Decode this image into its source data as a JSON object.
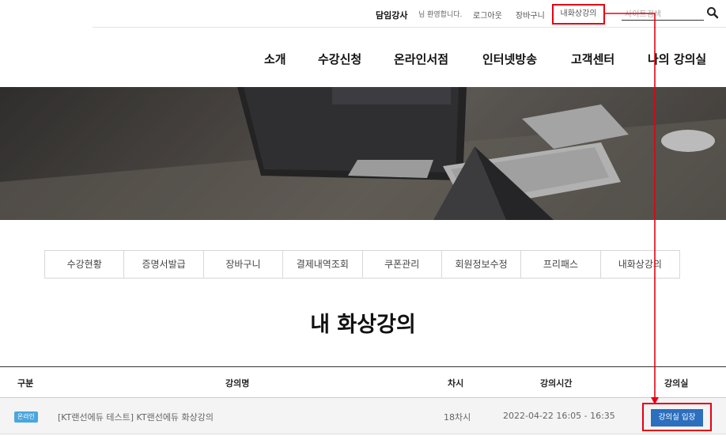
{
  "topbar": {
    "user_name": "담임강사",
    "welcome": "님 환영합니다.",
    "logout": "로그아웃",
    "cart": "장바구니",
    "my_video_class": "내화상강의",
    "search_placeholder": "사이트검색",
    "search_icon": "search-icon"
  },
  "nav": {
    "items": [
      "소개",
      "수강신청",
      "온라인서점",
      "인터넷방송",
      "고객센터",
      "나의 강의실"
    ]
  },
  "subtabs": [
    "수강현황",
    "증명서발급",
    "장바구니",
    "결제내역조회",
    "쿠폰관리",
    "회원정보수정",
    "프리패스",
    "내화상강의"
  ],
  "page_title": "내 화상강의",
  "table": {
    "headers": {
      "type": "구분",
      "name": "강의명",
      "session": "차시",
      "time": "강의시간",
      "room": "강의실"
    },
    "rows": [
      {
        "badge": "온라인",
        "name": "[KT랜선에듀 테스트] KT랜선에듀 화상강의",
        "session": "18차시",
        "time": "2022-04-22 16:05 - 16:35",
        "button": "강의실 입장"
      }
    ]
  },
  "colors": {
    "annotation": "#e60012",
    "button": "#2b6fbe",
    "badge": "#4aa6e0"
  }
}
